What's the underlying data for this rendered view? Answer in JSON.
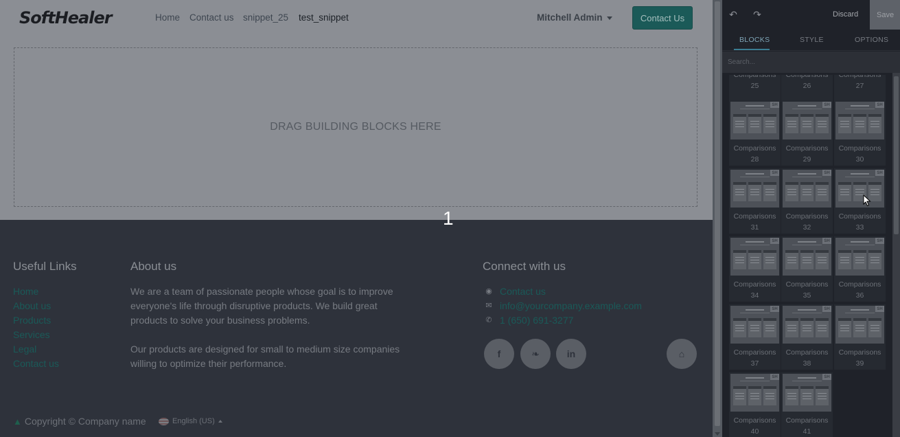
{
  "navbar": {
    "logo": "SoftHealer",
    "links": [
      "Home",
      "Contact us",
      "snippet_25",
      "test_snippet"
    ],
    "user": "Mitchell Admin",
    "cta": "Contact Us"
  },
  "content": {
    "dropzone_text": "DRAG BUILDING BLOCKS HERE",
    "page_number": "1"
  },
  "footer": {
    "useful_links_title": "Useful Links",
    "useful_links": [
      "Home",
      "About us",
      "Products",
      "Services",
      "Legal",
      "Contact us"
    ],
    "about_title": "About us",
    "about_p1": "We are a team of passionate people whose goal is to improve everyone's life through disruptive products. We build great products to solve your business problems.",
    "about_p2": "Our products are designed for small to medium size companies willing to optimize their performance.",
    "connect_title": "Connect with us",
    "contact_link": "Contact us",
    "email": "info@yourcompany.example.com",
    "phone": "1 (650) 691-3277",
    "copyright": "Copyright © Company name",
    "language": "English (US)"
  },
  "editor": {
    "discard": "Discard",
    "save": "Save",
    "tabs": [
      "BLOCKS",
      "STYLE",
      "OPTIONS"
    ],
    "search_placeholder": "Search...",
    "snippet_badge": "SH",
    "snippet_prefix": "Comparisons",
    "snippets": [
      "25",
      "26",
      "27",
      "28",
      "29",
      "30",
      "31",
      "32",
      "33",
      "34",
      "35",
      "36",
      "37",
      "38",
      "39",
      "40",
      "41"
    ]
  }
}
